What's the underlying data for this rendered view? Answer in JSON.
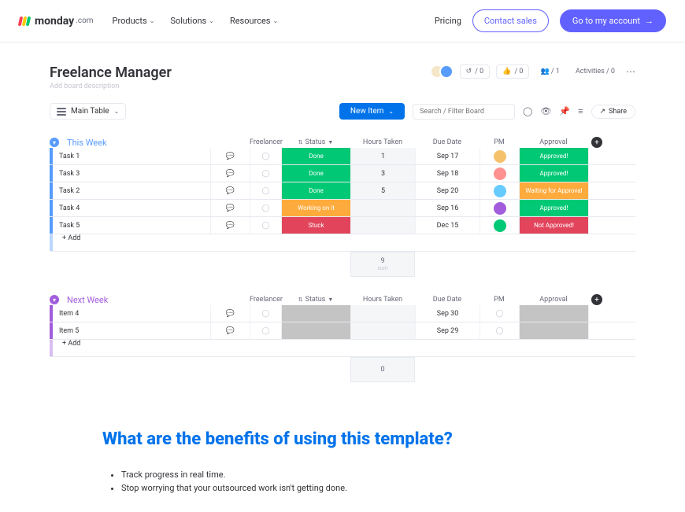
{
  "nav": {
    "logo": "monday",
    "logo_suffix": ".com",
    "items": [
      "Products",
      "Solutions",
      "Resources"
    ],
    "pricing": "Pricing",
    "contact": "Contact sales",
    "goto": "Go to my account",
    "arrow": "→"
  },
  "board": {
    "title": "Freelance Manager",
    "desc": "Add board description",
    "meta": {
      "invite": "/ 0",
      "like": "/ 0",
      "people": "/ 1",
      "activities": "Activities / 0"
    },
    "main_table": "Main Table",
    "new_item": "New Item",
    "search_placeholder": "Search / Filter Board",
    "share": "Share",
    "columns": [
      "",
      "Freelancer",
      "Status",
      "Hours Taken",
      "Due Date",
      "PM",
      "Approval"
    ],
    "sort_indicator": "▼"
  },
  "groups": [
    {
      "name": "This Week",
      "color": "blue",
      "rows": [
        {
          "task": "Task 1",
          "status": "Done",
          "status_c": "s-done",
          "hours": "1",
          "due": "Sep 17",
          "pm": "pm1",
          "approval": "Approved!",
          "approval_c": "a-approved"
        },
        {
          "task": "Task 3",
          "status": "Done",
          "status_c": "s-done",
          "hours": "3",
          "due": "Sep 18",
          "pm": "pm2",
          "approval": "Approved!",
          "approval_c": "a-approved"
        },
        {
          "task": "Task 2",
          "status": "Done",
          "status_c": "s-done",
          "hours": "5",
          "due": "Sep 20",
          "pm": "pm3",
          "approval": "Waiting for Approval",
          "approval_c": "a-waiting"
        },
        {
          "task": "Task 4",
          "status": "Working on it",
          "status_c": "s-working",
          "hours": "",
          "due": "Sep 16",
          "pm": "pm4",
          "approval": "Approved!",
          "approval_c": "a-approved"
        },
        {
          "task": "Task 5",
          "status": "Stuck",
          "status_c": "s-stuck",
          "hours": "",
          "due": "Dec 15",
          "pm": "pm5",
          "approval": "Not Approved!",
          "approval_c": "a-not"
        }
      ],
      "add": "+ Add",
      "sum": "9",
      "sum_label": "sum"
    },
    {
      "name": "Next Week",
      "color": "purple",
      "rows": [
        {
          "task": "Item 4",
          "status": "",
          "status_c": "s-grey",
          "hours": "",
          "due": "Sep 30",
          "pm": "",
          "approval": "",
          "approval_c": "a-grey"
        },
        {
          "task": "Item 5",
          "status": "",
          "status_c": "s-grey",
          "hours": "",
          "due": "Sep 29",
          "pm": "",
          "approval": "",
          "approval_c": "a-grey"
        }
      ],
      "add": "+ Add",
      "sum": "0",
      "sum_label": ""
    }
  ],
  "benefits": {
    "heading": "What are the benefits of using this template?",
    "items": [
      "Track progress in real time.",
      "Stop worrying that your outsourced work isn't getting done."
    ]
  }
}
